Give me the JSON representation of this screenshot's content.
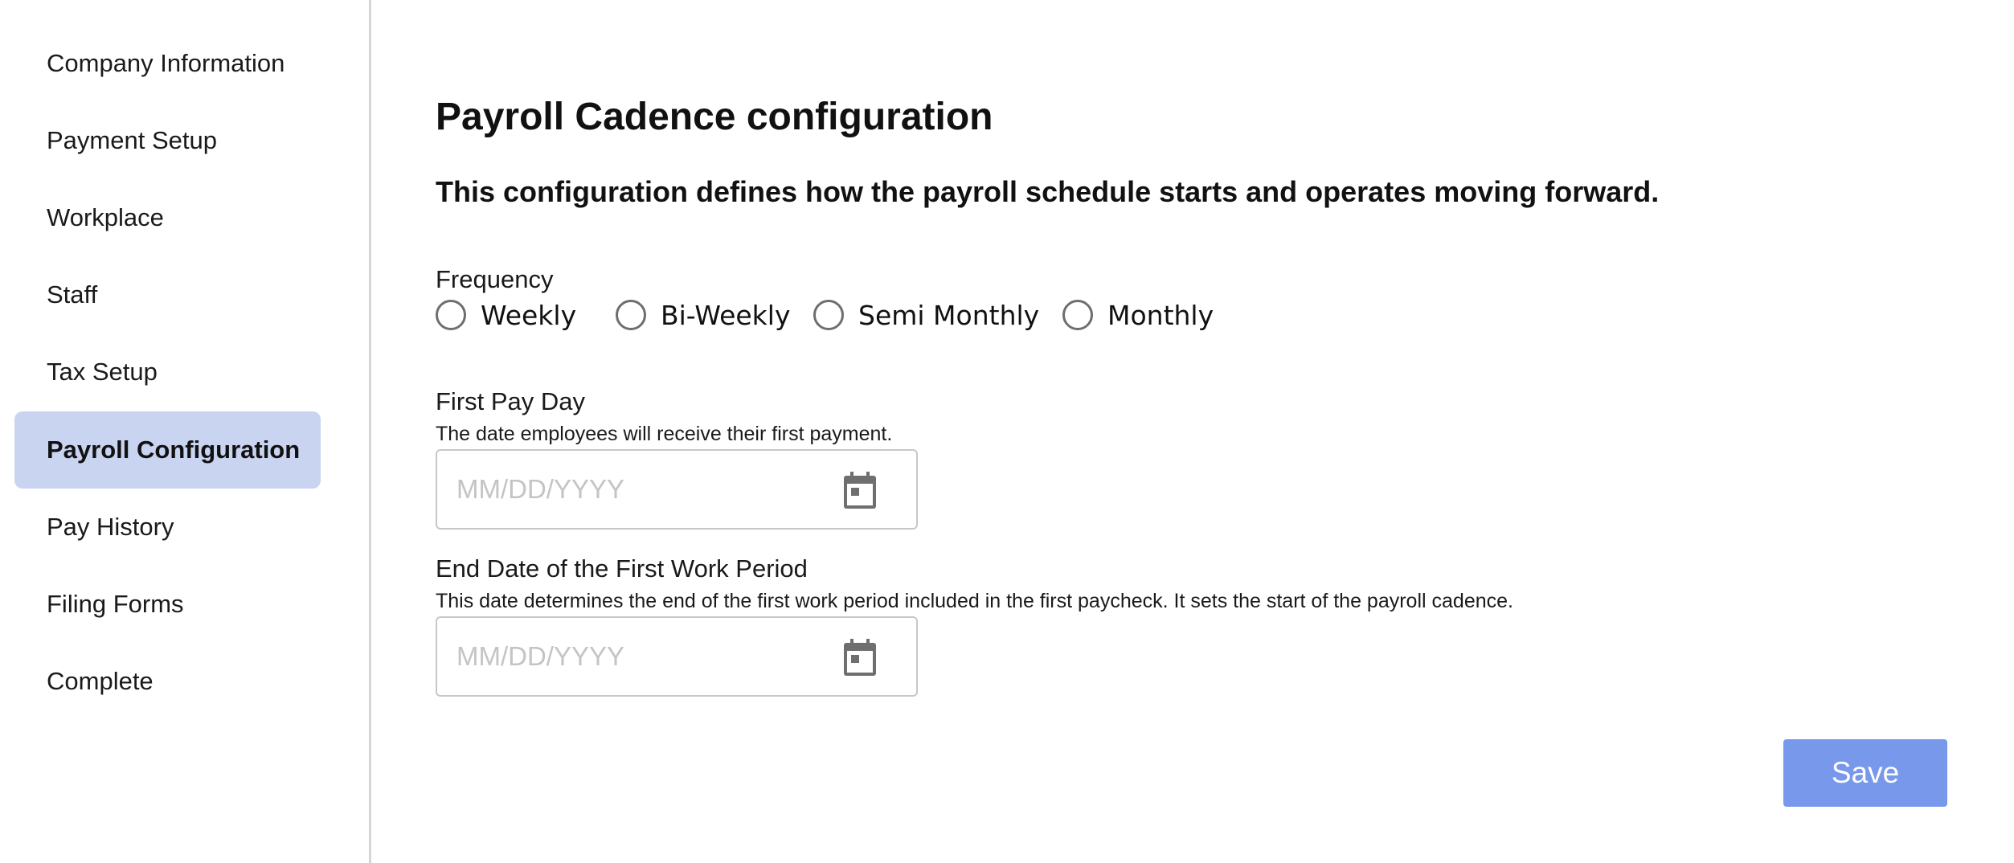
{
  "sidebar": {
    "items": [
      {
        "label": "Company Information",
        "active": false
      },
      {
        "label": "Payment Setup",
        "active": false
      },
      {
        "label": "Workplace",
        "active": false
      },
      {
        "label": "Staff",
        "active": false
      },
      {
        "label": "Tax Setup",
        "active": false
      },
      {
        "label": "Payroll Configuration",
        "active": true
      },
      {
        "label": "Pay History",
        "active": false
      },
      {
        "label": "Filing Forms",
        "active": false
      },
      {
        "label": "Complete",
        "active": false
      }
    ]
  },
  "main": {
    "title": "Payroll Cadence configuration",
    "subtitle": "This configuration defines how the payroll schedule starts and operates moving forward.",
    "frequency": {
      "label": "Frequency",
      "options": [
        "Weekly",
        "Bi-Weekly",
        "Semi Monthly",
        "Monthly"
      ],
      "selected": null
    },
    "first_pay_day": {
      "label": "First Pay Day",
      "help": "The date employees will receive their first payment.",
      "placeholder": "MM/DD/YYYY",
      "value": "",
      "icon": "calendar-icon"
    },
    "end_date": {
      "label": "End Date of the First Work Period",
      "help": "This date determines the end of the first work period included in the first paycheck. It sets the start of the payroll cadence.",
      "placeholder": "MM/DD/YYYY",
      "value": "",
      "icon": "calendar-icon"
    },
    "save_label": "Save"
  },
  "colors": {
    "active_nav_bg": "#c9d4f1",
    "save_button_bg": "#7898ec",
    "radio_border": "#6e6e6e",
    "divider": "#d6d6d6"
  }
}
